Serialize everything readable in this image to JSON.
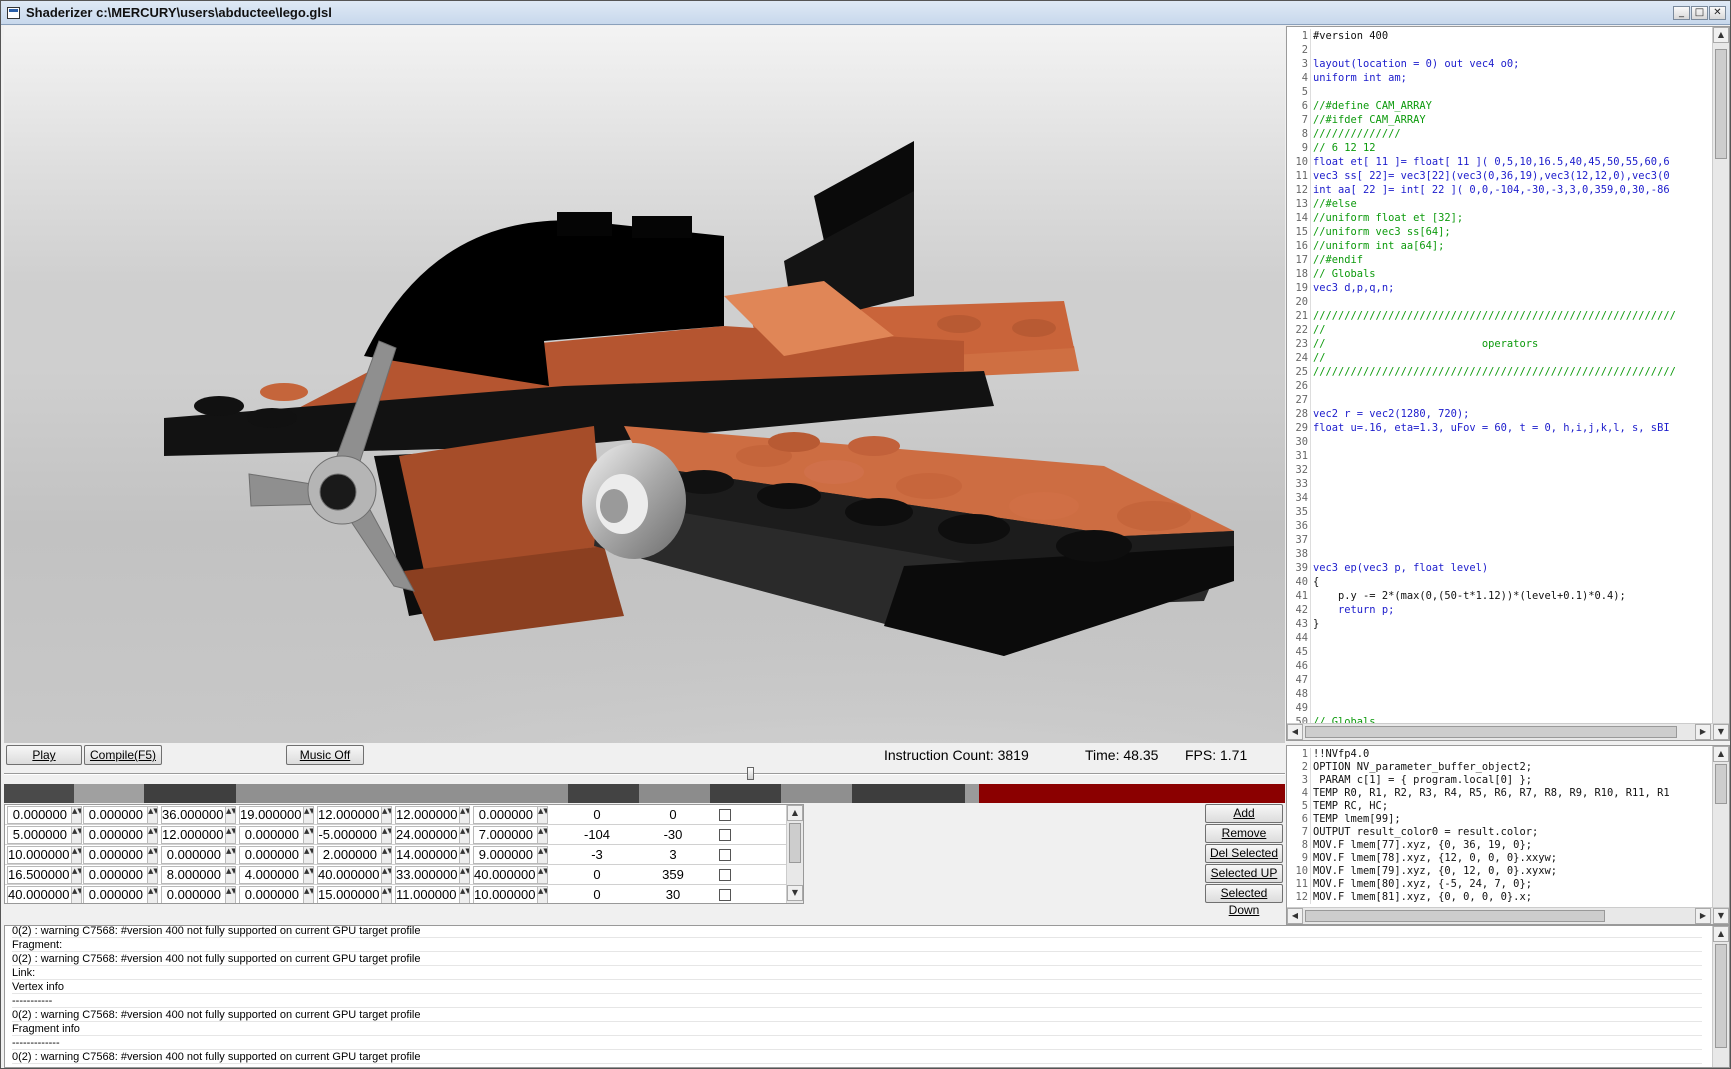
{
  "window": {
    "title": "Shaderizer c:\\MERCURY\\users\\abductee\\lego.glsl",
    "min_glyph": "_",
    "max_glyph": "□",
    "close_glyph": "✕"
  },
  "source_editor": {
    "lines": [
      {
        "n": "1",
        "text": "#version 400",
        "kind": "plain"
      },
      {
        "n": "2",
        "text": "",
        "kind": "plain"
      },
      {
        "n": "3",
        "text": "layout(location = 0) out vec4 o0;",
        "kind": "type"
      },
      {
        "n": "4",
        "text": "uniform int am;",
        "kind": "type"
      },
      {
        "n": "5",
        "text": "",
        "kind": "plain"
      },
      {
        "n": "6",
        "text": "//#define CAM_ARRAY",
        "kind": "comment"
      },
      {
        "n": "7",
        "text": "//#ifdef CAM_ARRAY",
        "kind": "comment"
      },
      {
        "n": "8",
        "text": "//////////////",
        "kind": "comment"
      },
      {
        "n": "9",
        "text": "// 6 12 12",
        "kind": "comment"
      },
      {
        "n": "10",
        "text": "float et[ 11 ]= float[ 11 ]( 0,5,10,16.5,40,45,50,55,60,6",
        "kind": "type"
      },
      {
        "n": "11",
        "text": "vec3 ss[ 22]= vec3[22](vec3(0,36,19),vec3(12,12,0),vec3(0",
        "kind": "type"
      },
      {
        "n": "12",
        "text": "int aa[ 22 ]= int[ 22 ]( 0,0,-104,-30,-3,3,0,359,0,30,-86",
        "kind": "type"
      },
      {
        "n": "13",
        "text": "//#else",
        "kind": "comment"
      },
      {
        "n": "14",
        "text": "//uniform float et [32];",
        "kind": "comment"
      },
      {
        "n": "15",
        "text": "//uniform vec3 ss[64];",
        "kind": "comment"
      },
      {
        "n": "16",
        "text": "//uniform int aa[64];",
        "kind": "comment"
      },
      {
        "n": "17",
        "text": "//#endif",
        "kind": "comment"
      },
      {
        "n": "18",
        "text": "// Globals",
        "kind": "comment"
      },
      {
        "n": "19",
        "text": "vec3 d,p,q,n;",
        "kind": "type"
      },
      {
        "n": "20",
        "text": "",
        "kind": "plain"
      },
      {
        "n": "21",
        "text": "//////////////////////////////////////////////////////////",
        "kind": "comment"
      },
      {
        "n": "22",
        "text": "//",
        "kind": "comment"
      },
      {
        "n": "23",
        "text": "//                         operators",
        "kind": "comment"
      },
      {
        "n": "24",
        "text": "//",
        "kind": "comment"
      },
      {
        "n": "25",
        "text": "//////////////////////////////////////////////////////////",
        "kind": "comment"
      },
      {
        "n": "26",
        "text": "",
        "kind": "plain"
      },
      {
        "n": "27",
        "text": "",
        "kind": "plain"
      },
      {
        "n": "28",
        "text": "vec2 r = vec2(1280, 720);",
        "kind": "type"
      },
      {
        "n": "29",
        "text": "float u=.16, eta=1.3, uFov = 60, t = 0, h,i,j,k,l, s, sBI",
        "kind": "type"
      },
      {
        "n": "30",
        "text": "",
        "kind": "plain"
      },
      {
        "n": "31",
        "text": "",
        "kind": "plain"
      },
      {
        "n": "32",
        "text": "",
        "kind": "plain"
      },
      {
        "n": "33",
        "text": "",
        "kind": "plain"
      },
      {
        "n": "34",
        "text": "",
        "kind": "plain"
      },
      {
        "n": "35",
        "text": "",
        "kind": "plain"
      },
      {
        "n": "36",
        "text": "",
        "kind": "plain"
      },
      {
        "n": "37",
        "text": "",
        "kind": "plain"
      },
      {
        "n": "38",
        "text": "",
        "kind": "plain"
      },
      {
        "n": "39",
        "text": "vec3 ep(vec3 p, float level)",
        "kind": "type"
      },
      {
        "n": "40",
        "text": "{",
        "kind": "plain"
      },
      {
        "n": "41",
        "text": "    p.y -= 2*(max(0,(50-t*1.12))*(level+0.1)*0.4);",
        "kind": "plain"
      },
      {
        "n": "42",
        "text": "    return p;",
        "kind": "type"
      },
      {
        "n": "43",
        "text": "}",
        "kind": "plain"
      },
      {
        "n": "44",
        "text": "",
        "kind": "plain"
      },
      {
        "n": "45",
        "text": "",
        "kind": "plain"
      },
      {
        "n": "46",
        "text": "",
        "kind": "plain"
      },
      {
        "n": "47",
        "text": "",
        "kind": "plain"
      },
      {
        "n": "48",
        "text": "",
        "kind": "plain"
      },
      {
        "n": "49",
        "text": "",
        "kind": "plain"
      },
      {
        "n": "50",
        "text": "// Globals",
        "kind": "comment"
      }
    ]
  },
  "asm_editor": {
    "lines": [
      {
        "n": "1",
        "text": "!!NVfp4.0"
      },
      {
        "n": "2",
        "text": "OPTION NV_parameter_buffer_object2;"
      },
      {
        "n": "3",
        "text": " PARAM c[1] = { program.local[0] };"
      },
      {
        "n": "4",
        "text": "TEMP R0, R1, R2, R3, R4, R5, R6, R7, R8, R9, R10, R11, R1"
      },
      {
        "n": "5",
        "text": "TEMP RC, HC;"
      },
      {
        "n": "6",
        "text": "TEMP lmem[99];"
      },
      {
        "n": "7",
        "text": "OUTPUT result_color0 = result.color;"
      },
      {
        "n": "8",
        "text": "MOV.F lmem[77].xyz, {0, 36, 19, 0};"
      },
      {
        "n": "9",
        "text": "MOV.F lmem[78].xyz, {12, 0, 0, 0}.xxyw;"
      },
      {
        "n": "10",
        "text": "MOV.F lmem[79].xyz, {0, 12, 0, 0}.xyxw;"
      },
      {
        "n": "11",
        "text": "MOV.F lmem[80].xyz, {-5, 24, 7, 0};"
      },
      {
        "n": "12",
        "text": "MOV.F lmem[81].xyz, {0, 0, 0, 0}.x;"
      }
    ]
  },
  "toolbar": {
    "play_label": "Play",
    "compile_label": "Compile(F5)",
    "music_label": "Music Off",
    "instruction_count": "Instruction Count: 3819",
    "time": "Time: 48.35",
    "fps": "FPS: 1.71"
  },
  "timeline": {
    "position_fraction": 0.58,
    "segments": [
      {
        "c": "#4a4a4a",
        "w": 70
      },
      {
        "c": "#a0a0a0",
        "w": 70
      },
      {
        "c": "#3f3f3f",
        "w": 92
      },
      {
        "c": "#909090",
        "w": 332
      },
      {
        "c": "#434343",
        "w": 71
      },
      {
        "c": "#8c8c8c",
        "w": 71
      },
      {
        "c": "#414141",
        "w": 71
      },
      {
        "c": "#8f8f8f",
        "w": 71
      },
      {
        "c": "#3d3d3d",
        "w": 113
      },
      {
        "c": "#9a9a9a",
        "w": 14
      },
      {
        "c": "#8b0000",
        "w": 306
      }
    ]
  },
  "param_grid": {
    "rows": [
      {
        "v": [
          "0.000000",
          "0.000000",
          "36.000000",
          "19.000000",
          "12.000000",
          "12.000000",
          "0.000000"
        ],
        "a": "0",
        "b": "0"
      },
      {
        "v": [
          "5.000000",
          "0.000000",
          "12.000000",
          "0.000000",
          "-5.000000",
          "24.000000",
          "7.000000"
        ],
        "a": "-104",
        "b": "-30"
      },
      {
        "v": [
          "10.000000",
          "0.000000",
          "0.000000",
          "0.000000",
          "2.000000",
          "14.000000",
          "9.000000"
        ],
        "a": "-3",
        "b": "3"
      },
      {
        "v": [
          "16.500000",
          "0.000000",
          "8.000000",
          "4.000000",
          "40.000000",
          "33.000000",
          "40.000000"
        ],
        "a": "0",
        "b": "359"
      },
      {
        "v": [
          "40.000000",
          "0.000000",
          "0.000000",
          "0.000000",
          "15.000000",
          "11.000000",
          "10.000000"
        ],
        "a": "0",
        "b": "30"
      }
    ]
  },
  "side_buttons": {
    "add": "Add",
    "remove": "Remove",
    "del_selected": "Del Selected",
    "selected_up": "Selected UP",
    "selected_down": "Selected Down"
  },
  "log": {
    "lines": [
      "0(2) : warning C7568: #version 400 not fully supported on current GPU target profile",
      "Fragment:",
      "0(2) : warning C7568: #version 400 not fully supported on current GPU target profile",
      "Link:",
      "Vertex info",
      "-----------",
      "0(2) : warning C7568: #version 400 not fully supported on current GPU target profile",
      "Fragment info",
      "-------------",
      "0(2) : warning C7568: #version 400 not fully supported on current GPU target profile"
    ]
  },
  "colors": {
    "brick_orange": "#b0532c",
    "brick_light": "#d9784a",
    "brick_black": "#0a0a0a",
    "stud_dark": "#1b1b1b",
    "propeller": "#8c8c8c",
    "comment": "#0c9a0c",
    "keyword": "#1c1ccc"
  }
}
